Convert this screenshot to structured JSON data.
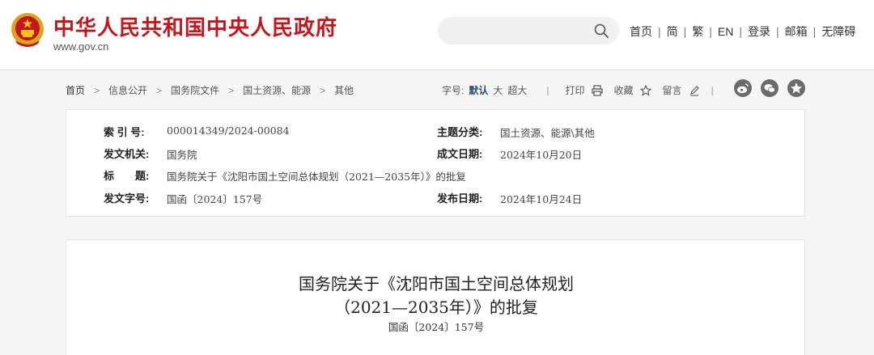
{
  "header": {
    "site_title": "中华人民共和国中央人民政府",
    "site_url": "www.gov.cn",
    "search_placeholder": "",
    "nav": [
      "首页",
      "简",
      "繁",
      "EN",
      "登录",
      "邮箱",
      "无障碍"
    ],
    "nav_separator": "|"
  },
  "breadcrumb": {
    "items": [
      "首页",
      "信息公开",
      "国务院文件",
      "国土资源、能源",
      "其他"
    ],
    "arrow": ">"
  },
  "tools": {
    "font_size_label": "字号:",
    "font_default": "默认",
    "font_large": "大",
    "font_xlarge": "超大",
    "separator": "|",
    "print": "打印",
    "favorite": "收藏",
    "comment": "留言"
  },
  "share": [
    "weibo-icon",
    "wechat-icon",
    "qzone-icon"
  ],
  "meta": {
    "index_label": "索 引 号:",
    "index_value": "000014349/2024-00084",
    "category_label": "主题分类:",
    "category_value": "国土资源、能源\\其他",
    "issuer_label": "发文机关:",
    "issuer_value": "国务院",
    "written_label": "成文日期:",
    "written_value": "2024年10月20日",
    "title_label": "标　　题:",
    "title_value": "国务院关于《沈阳市国土空间总体规划（2021—2035年）》的批复",
    "docno_label": "发文字号:",
    "docno_value": "国函〔2024〕157号",
    "published_label": "发布日期:",
    "published_value": "2024年10月24日"
  },
  "article": {
    "title_line1": "国务院关于《沈阳市国土空间总体规划",
    "title_line2": "（2021—2035年）》的批复",
    "doc_number": "国函〔2024〕157号"
  },
  "colors": {
    "brand_red": "#c2171c",
    "accent_blue": "#2b4a78"
  }
}
